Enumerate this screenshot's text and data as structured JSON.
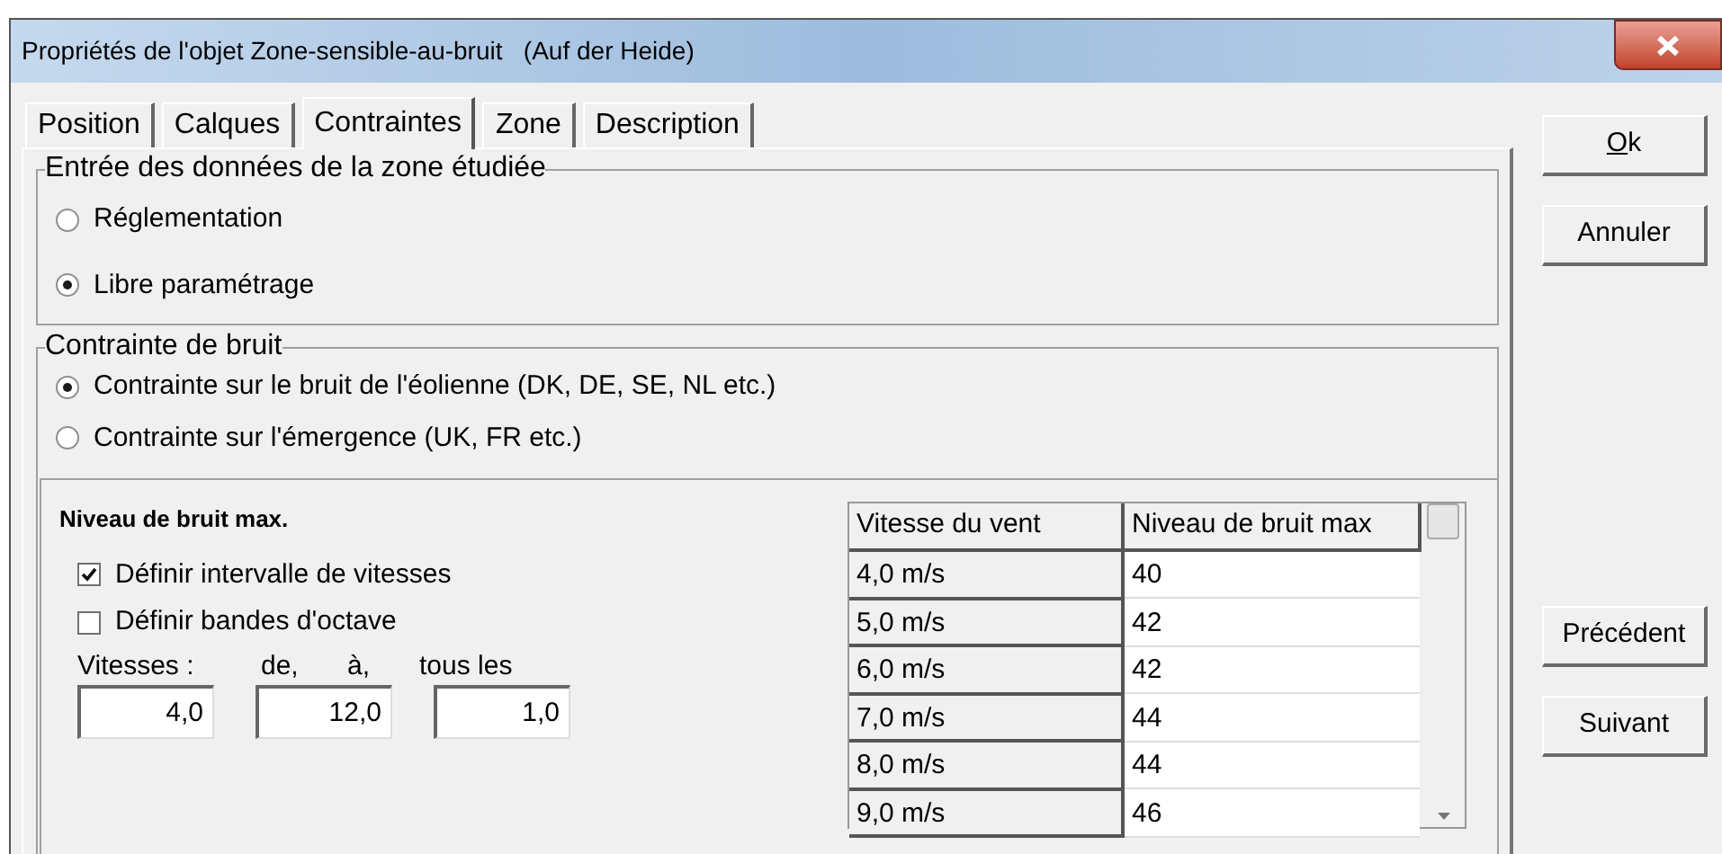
{
  "window": {
    "title": "Propriétés de l'objet Zone-sensible-au-bruit   (Auf der Heide)"
  },
  "tabs": [
    {
      "label": "Position",
      "selected": false
    },
    {
      "label": "Calques",
      "selected": false
    },
    {
      "label": "Contraintes",
      "selected": true
    },
    {
      "label": "Zone",
      "selected": false
    },
    {
      "label": "Description",
      "selected": false
    }
  ],
  "input_group": {
    "title": "Entrée des données de la zone étudiée",
    "options": [
      {
        "label": "Réglementation",
        "selected": false
      },
      {
        "label": "Libre paramétrage",
        "selected": true
      }
    ]
  },
  "noise_group": {
    "title": "Contrainte de bruit",
    "options": [
      {
        "label": "Contrainte sur le bruit de l'éolienne (DK, DE, SE, NL etc.)",
        "selected": true
      },
      {
        "label": "Contrainte sur l'émergence (UK, FR etc.)",
        "selected": false
      }
    ]
  },
  "max_level": {
    "title": "Niveau de bruit max.",
    "checkboxes": [
      {
        "label": "Définir intervalle de vitesses",
        "checked": true
      },
      {
        "label": "Définir bandes d'octave",
        "checked": false
      }
    ],
    "speeds_label": "Vitesses :",
    "from_label": "de,",
    "to_label": "à,",
    "step_label": "tous les",
    "from": "4,0",
    "to": "12,0",
    "step": "1,0"
  },
  "table": {
    "columns": [
      "Vitesse du vent",
      "Niveau de bruit max"
    ],
    "rows": [
      [
        "4,0 m/s",
        "40"
      ],
      [
        "5,0 m/s",
        "42"
      ],
      [
        "6,0 m/s",
        "42"
      ],
      [
        "7,0 m/s",
        "44"
      ],
      [
        "8,0 m/s",
        "44"
      ],
      [
        "9,0 m/s",
        "46"
      ]
    ]
  },
  "buttons": {
    "ok": "Ok",
    "cancel": "Annuler",
    "previous": "Précédent",
    "next": "Suivant"
  }
}
